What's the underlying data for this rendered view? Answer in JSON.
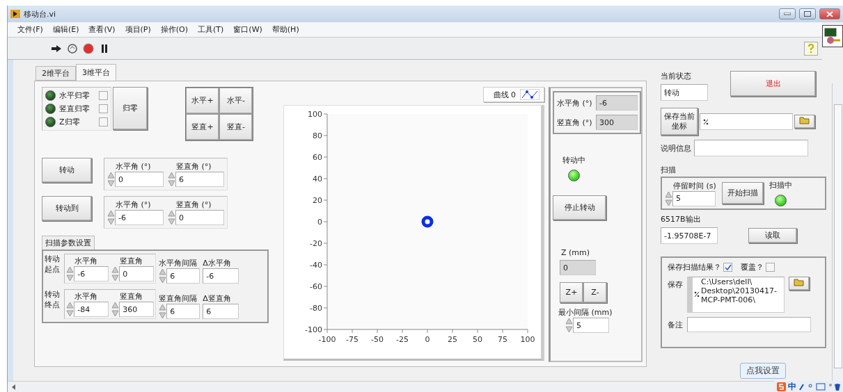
{
  "window": {
    "title": "移动台.vi"
  },
  "menu": [
    "文件(F)",
    "编辑(E)",
    "查看(V)",
    "项目(P)",
    "操作(O)",
    "工具(T)",
    "窗口(W)",
    "帮助(H)"
  ],
  "tabs": [
    {
      "label": "2维平台",
      "selected": false
    },
    {
      "label": "3维平台",
      "selected": true
    }
  ],
  "zeroing": {
    "items": [
      {
        "label": "水平归零",
        "on": false,
        "checked": false
      },
      {
        "label": "竖直归零",
        "on": false,
        "checked": false
      },
      {
        "label": "Z归零",
        "on": false,
        "checked": false
      }
    ],
    "button": "归零"
  },
  "jog_buttons": [
    "水平+",
    "水平-",
    "竖直+",
    "竖直-"
  ],
  "moves": [
    {
      "button": "转动",
      "fields": [
        {
          "label": "水平角 (°)",
          "value": "0"
        },
        {
          "label": "竖直角 (°)",
          "value": "6"
        }
      ]
    },
    {
      "button": "转动到",
      "fields": [
        {
          "label": "水平角 (°)",
          "value": "-6"
        },
        {
          "label": "竖直角 (°)",
          "value": "0"
        }
      ]
    }
  ],
  "scan_params": {
    "title": "扫描参数设置",
    "rows": [
      {
        "label": "转动起点",
        "fields": [
          {
            "label": "水平角",
            "value": "-6"
          },
          {
            "label": "竖直角",
            "value": "0"
          }
        ],
        "interval": {
          "label": "水平角间隔",
          "value": "6"
        },
        "delta": {
          "label": "Δ水平角",
          "value": "-6"
        }
      },
      {
        "label": "转动终点",
        "fields": [
          {
            "label": "水平角",
            "value": "-84"
          },
          {
            "label": "竖直角",
            "value": "360"
          }
        ],
        "interval": {
          "label": "竖直角间隔",
          "value": "6"
        },
        "delta": {
          "label": "Δ竖直角",
          "value": "6"
        }
      }
    ]
  },
  "chart": {
    "chart_data": {
      "type": "scatter",
      "x": [
        0
      ],
      "series": [
        {
          "name": "曲线 0",
          "color": "#0a2ee8",
          "values": [
            0
          ]
        }
      ],
      "xlim": [
        -100,
        100
      ],
      "ylim": [
        -100,
        100
      ],
      "xticks": [
        -100,
        -75,
        -50,
        -25,
        0,
        25,
        50,
        75,
        100
      ],
      "yticks": [
        -100,
        -80,
        -60,
        -40,
        -20,
        0,
        20,
        40,
        60,
        80,
        100
      ]
    }
  },
  "position": [
    {
      "label": "水平角 (°)",
      "value": "-6"
    },
    {
      "label": "竖直角 (°)",
      "value": "300"
    }
  ],
  "rotating": {
    "label": "转动中",
    "on": true
  },
  "stop_button": "停止转动",
  "z": {
    "label": "Z (mm)",
    "value": "0",
    "buttons": [
      "Z+",
      "Z-"
    ],
    "step": {
      "label": "最小间隔 (mm)",
      "value": "5"
    }
  },
  "status": {
    "label": "当前状态",
    "value": "转动"
  },
  "exit_button": "退出",
  "save_coords": {
    "button": "保存当前坐标"
  },
  "description": {
    "label": "说明信息"
  },
  "scan": {
    "title": "扫描",
    "dwell": {
      "label": "停留时间 (s)",
      "value": "5"
    },
    "button": "开始扫描",
    "indicator": {
      "label": "扫描中",
      "on": true
    }
  },
  "output": {
    "label": "6517B输出",
    "value": "-1.95708E-7",
    "button": "读取"
  },
  "save": {
    "save_results": {
      "label": "保存扫描结果？",
      "checked": true
    },
    "overwrite": {
      "label": "覆盖？",
      "checked": false
    },
    "path": {
      "label": "保存",
      "lines": [
        "C:\\Users\\dell\\",
        "Desktop\\20130417-",
        "MCP-PMT-006\\"
      ]
    },
    "note": {
      "label": "备注"
    }
  },
  "tooltip": "点我设置",
  "ime": "中"
}
